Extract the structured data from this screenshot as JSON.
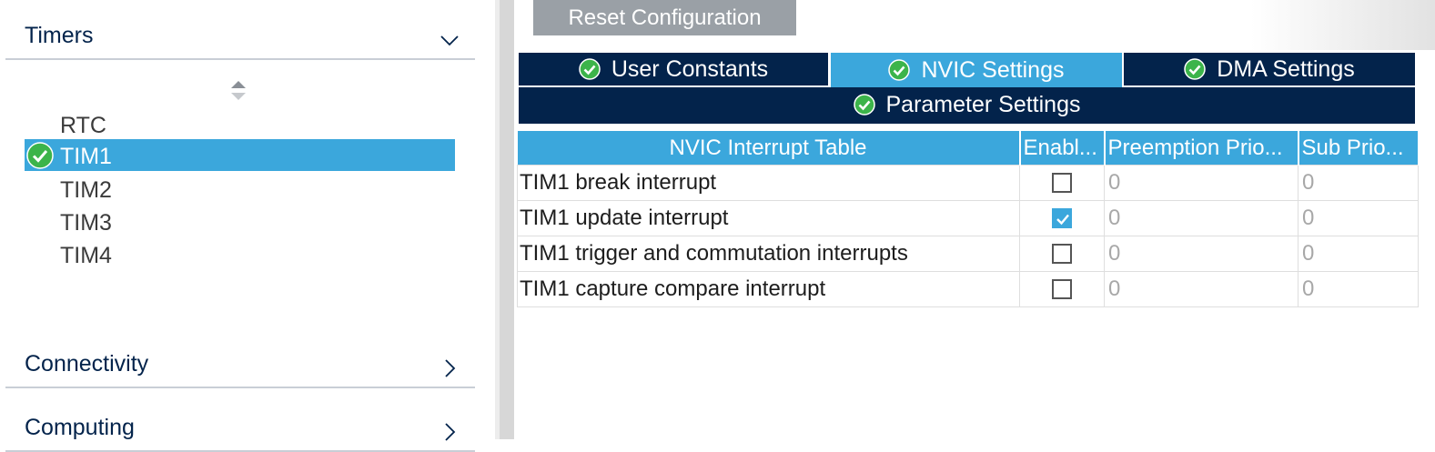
{
  "sidebar": {
    "categories": [
      {
        "label": "Timers",
        "expanded": true
      },
      {
        "label": "Connectivity",
        "expanded": false
      },
      {
        "label": "Computing",
        "expanded": false
      }
    ],
    "timer_items": [
      {
        "label": "RTC",
        "selected": false,
        "configured": false
      },
      {
        "label": "TIM1",
        "selected": true,
        "configured": true
      },
      {
        "label": "TIM2",
        "selected": false,
        "configured": false
      },
      {
        "label": "TIM3",
        "selected": false,
        "configured": false
      },
      {
        "label": "TIM4",
        "selected": false,
        "configured": false
      }
    ],
    "icons": {
      "expanded": "chevron-down-icon",
      "collapsed": "chevron-right-icon",
      "sort": "sort-arrows-icon",
      "ok": "check-circle-icon"
    }
  },
  "toolbar": {
    "reset_label": "Reset Configuration"
  },
  "tabs": [
    {
      "label": "User Constants",
      "active": false
    },
    {
      "label": "NVIC Settings",
      "active": true
    },
    {
      "label": "DMA Settings",
      "active": false
    },
    {
      "label": "Parameter Settings",
      "active": false
    }
  ],
  "nvic_table": {
    "columns": [
      "NVIC Interrupt Table",
      "Enabl...",
      "Preemption Prio...",
      "Sub Prio..."
    ],
    "rows": [
      {
        "name": "TIM1 break interrupt",
        "enabled": false,
        "preemption": "0",
        "sub": "0"
      },
      {
        "name": "TIM1 update interrupt",
        "enabled": true,
        "preemption": "0",
        "sub": "0"
      },
      {
        "name": "TIM1 trigger and commutation interrupts",
        "enabled": false,
        "preemption": "0",
        "sub": "0"
      },
      {
        "name": "TIM1 capture compare interrupt",
        "enabled": false,
        "preemption": "0",
        "sub": "0"
      }
    ]
  },
  "colors": {
    "navy": "#03234b",
    "accent": "#3ba7dc",
    "button_gray": "#9aa0a6",
    "ok_green": "#3cb44a"
  }
}
